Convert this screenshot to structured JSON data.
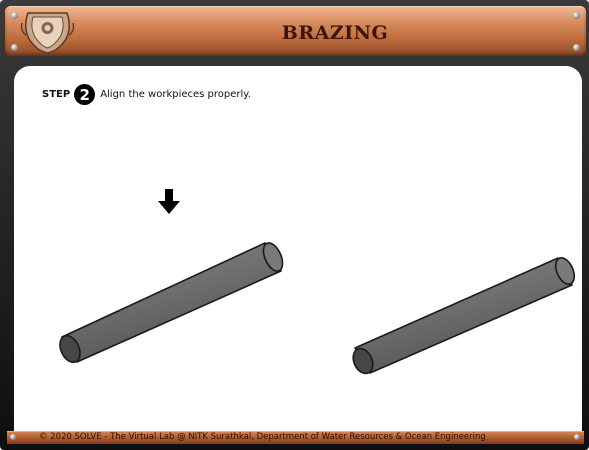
{
  "header": {
    "title": "BRAZING",
    "emblem_icon": "institute-emblem-icon"
  },
  "step": {
    "label": "STEP",
    "number": "2",
    "instruction": "Align the workpieces properly."
  },
  "arrow_icon": "arrow-down-icon",
  "workpieces": [
    {
      "name": "workpiece-rod-left"
    },
    {
      "name": "workpiece-rod-right"
    }
  ],
  "footer": {
    "text": "© 2020 SOLVE - The Virtual Lab @ NITK Surathkal, Department of Water Resources & Ocean Engineering"
  },
  "colors": {
    "header_copper": "#c37440",
    "title_text": "#3c1408",
    "rod_fill": "#707070",
    "background": "#ffffff"
  }
}
